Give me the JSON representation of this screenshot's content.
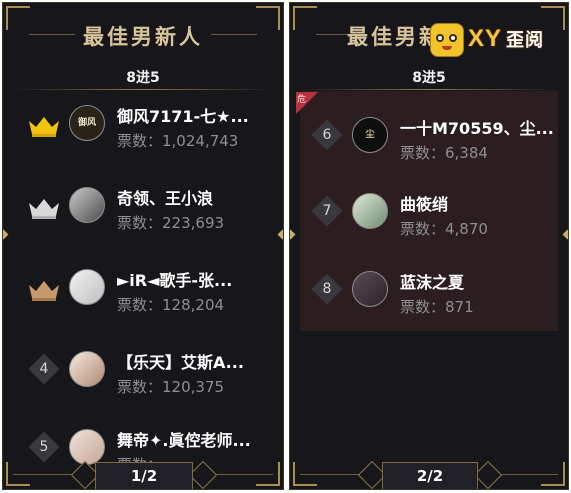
{
  "left_panel": {
    "title": "最佳男新人",
    "round": "8进5",
    "entries": [
      {
        "rank": "1",
        "rank_type": "crown-gold",
        "name": "御风7171-七★...",
        "votes": "票数：1,024,743",
        "avatar_text": "御风"
      },
      {
        "rank": "2",
        "rank_type": "crown-silver",
        "name": "奇领、王小浪",
        "votes": "票数：223,693",
        "avatar_text": ""
      },
      {
        "rank": "3",
        "rank_type": "crown-bronze",
        "name": "►iR◄歌手-张...",
        "votes": "票数：128,204",
        "avatar_text": ""
      },
      {
        "rank": "4",
        "rank_type": "number",
        "name": "【乐天】艾斯A...",
        "votes": "票数：120,375",
        "avatar_text": ""
      },
      {
        "rank": "5",
        "rank_type": "number",
        "name": "舞帝✦.眞倥老师...",
        "votes": "票数：",
        "avatar_text": ""
      }
    ],
    "pager": "1/2"
  },
  "right_panel": {
    "title": "最佳男新人",
    "round": "8进5",
    "flag_text": "危",
    "entries": [
      {
        "rank": "6",
        "rank_type": "number",
        "name": "一十M70559、尘...",
        "votes": "票数：6,384",
        "avatar_text": "尘"
      },
      {
        "rank": "7",
        "rank_type": "number",
        "name": "曲筱绡",
        "votes": "票数：4,870",
        "avatar_text": ""
      },
      {
        "rank": "8",
        "rank_type": "number",
        "name": "蓝沫之夏",
        "votes": "票数：871",
        "avatar_text": ""
      }
    ],
    "pager": "2/2"
  },
  "logo": {
    "brand": "XY",
    "brand_zh": "歪阅"
  },
  "colors": {
    "panel_bg": "#17161b",
    "gold": "#d8c59a",
    "crown_gold": "#f1c40f",
    "crown_silver": "#d7d7d7",
    "crown_bronze": "#c69a6a",
    "danger_bg": "#2b1d20",
    "danger_flag": "#b8343d"
  },
  "icons": {
    "crown": "crown-icon",
    "chevron_left": "chevron-left-icon",
    "chevron_right": "chevron-right-icon"
  }
}
